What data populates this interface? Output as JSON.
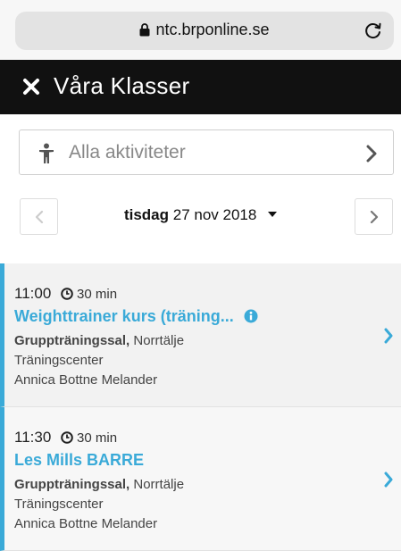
{
  "browser": {
    "url": "ntc.brponline.se"
  },
  "header": {
    "title": "Våra Klasser"
  },
  "filter": {
    "label": "Alla aktiviteter"
  },
  "date": {
    "day": "tisdag",
    "rest": "27 nov 2018"
  },
  "classes": [
    {
      "time": "11:00",
      "duration": "30 min",
      "title": "Weighttrainer kurs (träning...",
      "room": "Gruppträningssal,",
      "location": "Norrtälje",
      "center": "Träningscenter",
      "instructor": "Annica Bottne Melander"
    },
    {
      "time": "11:30",
      "duration": "30 min",
      "title": "Les Mills BARRE",
      "room": "Gruppträningssal,",
      "location": "Norrtälje",
      "center": "Träningscenter",
      "instructor": "Annica Bottne Melander"
    }
  ],
  "colors": {
    "accent": "#3aaad8",
    "header_bg": "#111111"
  }
}
